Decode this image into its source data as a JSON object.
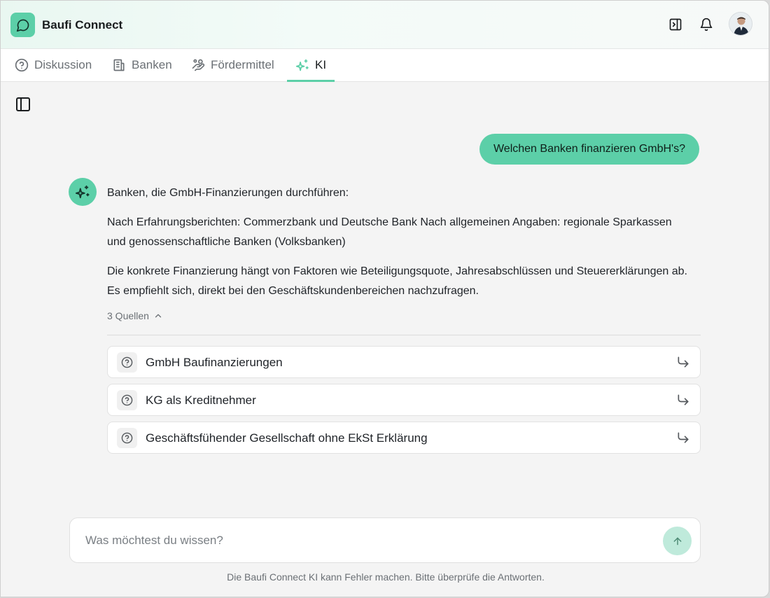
{
  "app": {
    "title": "Baufi Connect",
    "brand_color": "#5ccfa8"
  },
  "header": {
    "icons": [
      "sidebar-right-icon",
      "bell-icon",
      "avatar"
    ]
  },
  "tabs": [
    {
      "label": "Diskussion",
      "icon": "question-circle-icon",
      "active": false
    },
    {
      "label": "Banken",
      "icon": "bank-building-icon",
      "active": false
    },
    {
      "label": "Fördermittel",
      "icon": "hand-coins-icon",
      "active": false
    },
    {
      "label": "KI",
      "icon": "sparkles-icon",
      "active": true
    }
  ],
  "chat": {
    "user_message": "Welchen Banken finanzieren GmbH's?",
    "answer_paragraphs": [
      "Banken, die GmbH-Finanzierungen durchführen:",
      "Nach Erfahrungsberichten: Commerzbank und Deutsche Bank Nach allgemeinen Angaben: regionale Sparkassen und genossenschaftliche Banken (Volksbanken)",
      "Die konkrete Finanzierung hängt von Faktoren wie Beteiligungsquote, Jahresabschlüssen und Steuererklärungen ab. Es empfiehlt sich, direkt bei den Geschäftskundenbereichen nachzufragen."
    ],
    "sources_label": "3 Quellen",
    "sources": [
      {
        "title": "GmbH Baufinanzierungen"
      },
      {
        "title": "KG als Kreditnehmer"
      },
      {
        "title": "Geschäftsfühender Gesellschaft ohne EkSt Erklärung"
      }
    ]
  },
  "composer": {
    "placeholder": "Was möchtest du wissen?",
    "value": ""
  },
  "footer": {
    "disclaimer": "Die Baufi Connect KI kann Fehler machen. Bitte überprüfe die Antworten."
  }
}
